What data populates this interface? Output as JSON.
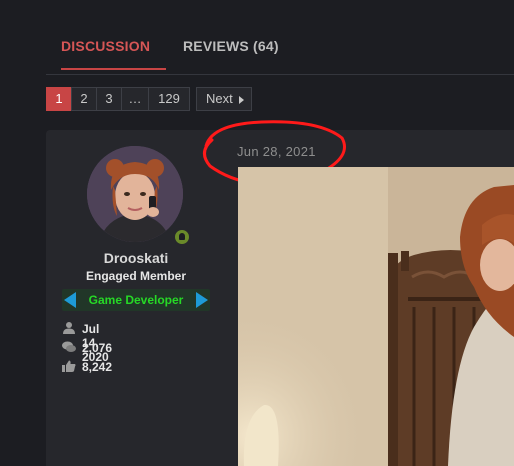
{
  "tabs": {
    "discussion": "DISCUSSION",
    "reviews": "REVIEWS (64)"
  },
  "pagination": {
    "pages": [
      "1",
      "2",
      "3",
      "…",
      "129"
    ],
    "active_page": "1",
    "next_label": "Next"
  },
  "post": {
    "date": "Jun 28, 2021",
    "user": {
      "name": "Drooskati",
      "title": "Engaged Member",
      "banner": "Game Developer",
      "joined": "Jul 14, 2020",
      "messages": "2,076",
      "reactions": "8,242"
    }
  },
  "colors": {
    "accent": "#c84545",
    "background": "#1c1d22",
    "panel": "#26272c",
    "banner_text": "#26d926",
    "banner_arrows": "#1e9ad6",
    "annotation_circle": "#ff1a1a"
  }
}
